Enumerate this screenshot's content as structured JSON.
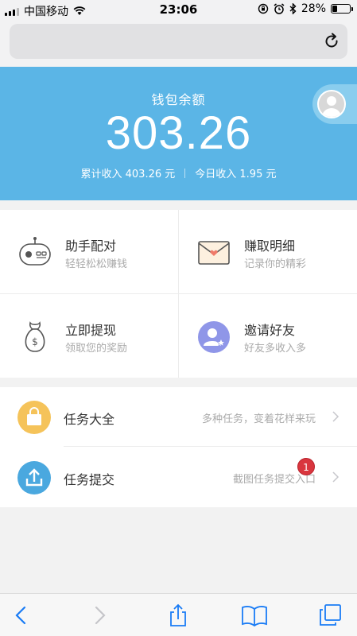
{
  "status_bar": {
    "carrier": "中国移动",
    "time": "23:06",
    "battery": "28%",
    "battery_level": 0.28
  },
  "wallet": {
    "label": "钱包余额",
    "balance": "303.26",
    "total_income": "累计收入 403.26 元",
    "today_income": "今日收入 1.95 元"
  },
  "grid": [
    {
      "title": "助手配对",
      "subtitle": "轻轻松松赚钱",
      "icon": "robot-icon"
    },
    {
      "title": "赚取明细",
      "subtitle": "记录你的精彩",
      "icon": "envelope-icon"
    },
    {
      "title": "立即提现",
      "subtitle": "领取您的奖励",
      "icon": "money-bag-icon"
    },
    {
      "title": "邀请好友",
      "subtitle": "好友多收入多",
      "icon": "invite-user-icon"
    }
  ],
  "list": [
    {
      "title": "任务大全",
      "desc": "多种任务，变着花样来玩",
      "icon": "shopping-bag-icon",
      "color": "#f5c35a"
    },
    {
      "title": "任务提交",
      "desc": "截图任务提交入口",
      "icon": "upload-icon",
      "color": "#4aa8df",
      "badge": "1"
    }
  ],
  "colors": {
    "primary": "#5bb5e6",
    "badge": "#d9363e",
    "toolbar_icon": "#1a7cf5"
  }
}
